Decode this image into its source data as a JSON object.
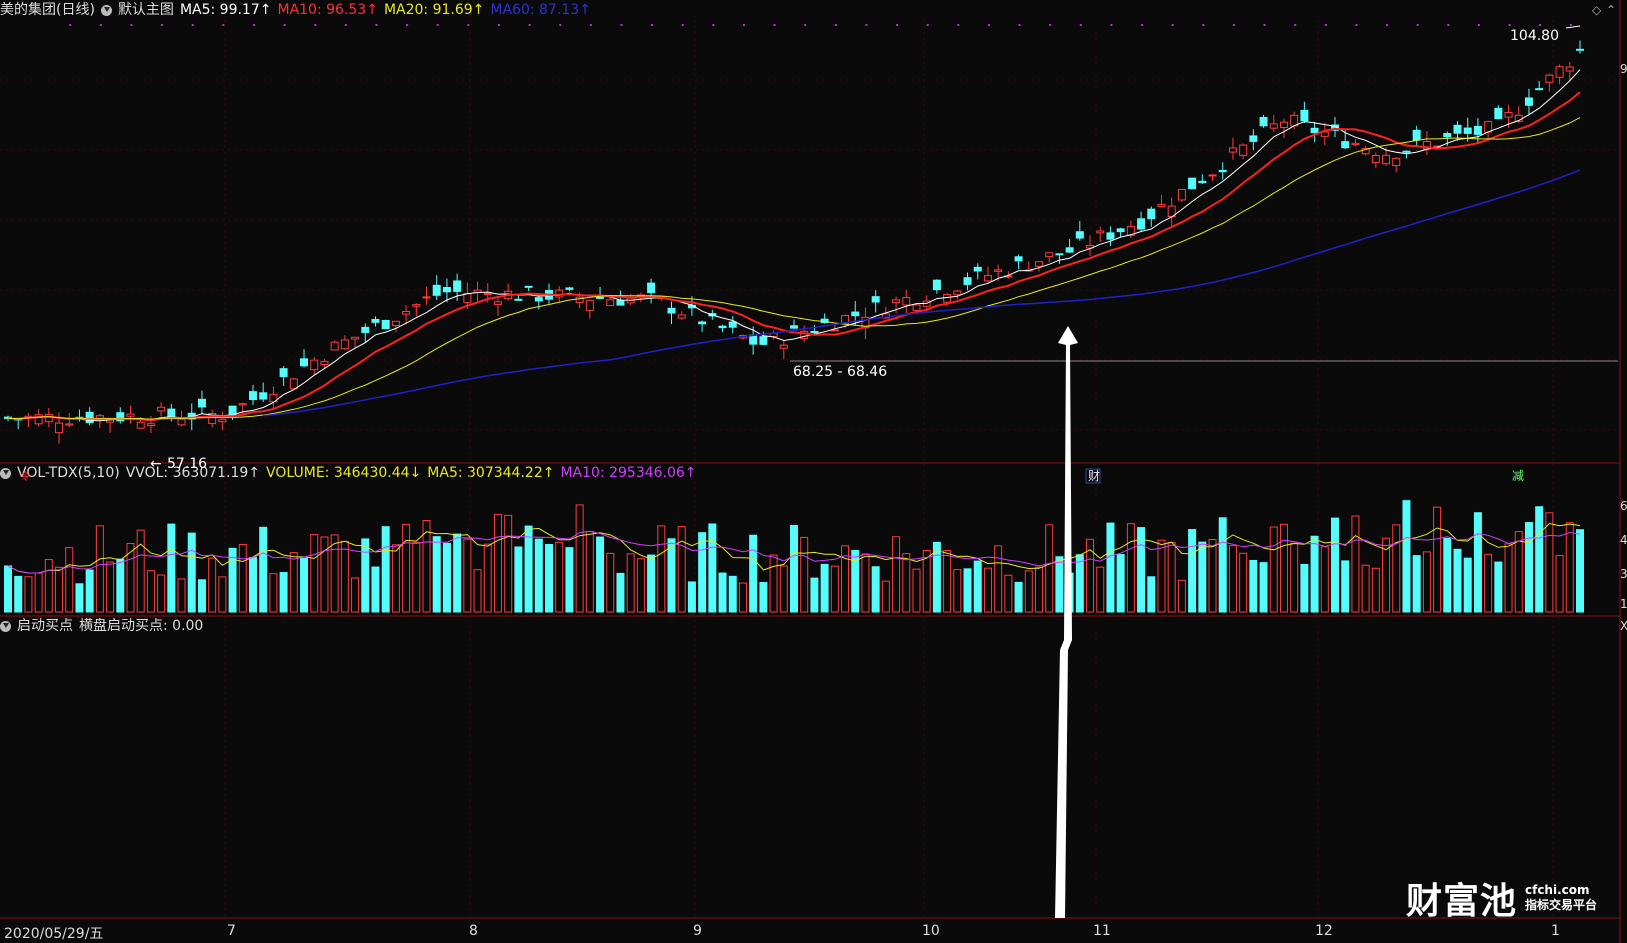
{
  "header_main": {
    "title": "美的集团(日线)",
    "template": "默认主图",
    "ma5": "MA5: 99.17↑",
    "ma10": "MA10: 96.53↑",
    "ma20": "MA20: 91.69↑",
    "ma60": "MA60: 87.13↑"
  },
  "header_vol": {
    "name": "VOL-TDX(5,10)",
    "vvol": "VVOL: 363071.19↑",
    "volume": "VOLUME: 346430.44↓",
    "ma5": "MA5: 307344.22↑",
    "ma10": "MA10: 295346.06↑"
  },
  "header_ind": {
    "name": "启动买点",
    "value": "横盘启动买点: 0.00"
  },
  "annotations": {
    "high_label": "104.80",
    "low_label": "57.16",
    "range_label": "68.25 - 68.46",
    "marker_cai": "财",
    "marker_jian": "减",
    "marker_left": "令"
  },
  "x_axis": {
    "start_date": "2020/05/29/五",
    "months": [
      "7",
      "8",
      "9",
      "10",
      "11",
      "12",
      "1"
    ]
  },
  "right_axis": {
    "price_tick": "9",
    "vol_ticks": [
      "6",
      "4",
      "3",
      "1",
      "X"
    ]
  },
  "logo": {
    "brand": "财富池",
    "domain": "cfchi.com",
    "slogan": "指标交易平台"
  },
  "colors": {
    "background": "#0a0a0a",
    "up_candle": "#ff3b3b",
    "down_candle": "#54fcfc",
    "ma5": "#ffffff",
    "ma10": "#ff2020",
    "ma20": "#e8e820",
    "ma60": "#2020c8",
    "vol_ma5": "#e8e820",
    "vol_ma10": "#d040ff",
    "arrow": "#ffffff"
  },
  "chart_data": {
    "type": "candlestick",
    "anchors": [
      {
        "x": "2020-05-29",
        "close": 59.5
      },
      {
        "x": "2020-06-30",
        "close": 60.0
      },
      {
        "x": "2020-07-15",
        "close": 68.0
      },
      {
        "x": "2020-07-31",
        "close": 75.0
      },
      {
        "x": "2020-08-31",
        "close": 74.0
      },
      {
        "x": "2020-09-15",
        "close": 68.5
      },
      {
        "x": "2020-09-30",
        "close": 72.5
      },
      {
        "x": "2020-10-30",
        "close": 80.0
      },
      {
        "x": "2020-11-10",
        "close": 84.0
      },
      {
        "x": "2020-11-30",
        "close": 96.0
      },
      {
        "x": "2020-12-15",
        "close": 92.0
      },
      {
        "x": "2020-12-31",
        "close": 95.0
      },
      {
        "x": "2021-01-12",
        "close": 104.5
      }
    ],
    "price_high": 104.8,
    "price_low": 57.16,
    "volume_last": 346430.44
  }
}
